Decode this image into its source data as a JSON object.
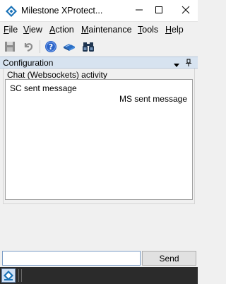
{
  "window": {
    "title": "Milestone XProtect...",
    "controls": [
      "minimize-icon",
      "maximize-icon",
      "close-icon"
    ]
  },
  "menu": {
    "items": [
      {
        "first": "F",
        "rest": "ile"
      },
      {
        "first": "V",
        "rest": "iew"
      },
      {
        "first": "A",
        "rest": "ction"
      },
      {
        "first": "M",
        "rest": "aintenance"
      },
      {
        "first": "T",
        "rest": "ools"
      },
      {
        "first": "H",
        "rest": "elp"
      }
    ]
  },
  "toolbar": {
    "icons": [
      "save-icon",
      "undo-icon",
      "help-icon",
      "book-icon",
      "binoculars-icon"
    ]
  },
  "pane": {
    "title": "Configuration",
    "icons": [
      "dropdown-arrow-icon",
      "pin-icon"
    ]
  },
  "chat": {
    "group_label": "Chat (Websockets) activity",
    "messages": [
      {
        "text": "SC sent message",
        "align": "left"
      },
      {
        "text": "MS sent message",
        "align": "right"
      }
    ]
  },
  "compose": {
    "input_value": "",
    "send_label": "Send"
  },
  "colors": {
    "pane_header_bg": "#d7e3f0",
    "input_border": "#7a9cc6",
    "statusbar_bg": "#2b2b2b"
  }
}
